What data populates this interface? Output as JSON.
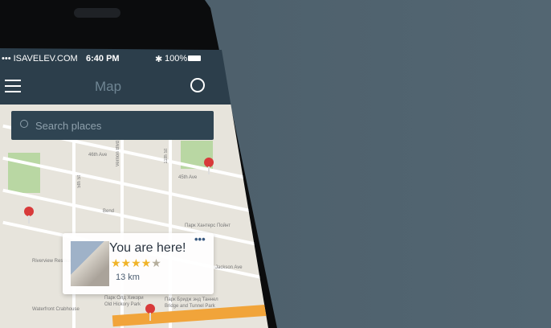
{
  "status_bar": {
    "carrier": "••• ISAVELEV.COM",
    "time": "6:40 PM",
    "bluetooth_icon": "bluetooth-icon",
    "battery": "100%"
  },
  "nav_bar": {
    "title": "Map",
    "menu_icon": "hamburger-icon",
    "locate_icon": "crosshair-icon"
  },
  "search": {
    "placeholder": "Search places"
  },
  "map_labels": [
    "46th Ave",
    "45th Ave",
    "5th St",
    "Vernon Blvd",
    "11th St",
    "Bend",
    "Парк Хантерс Пойнт",
    "Jackson Ave",
    "Парк Олд Хикори",
    "Old Hickory Park",
    "Парк Бридж энд Таннел",
    "Bridge and Tunnel Park",
    "Riverview Restaurant & Lounge",
    "Waterfront Crabhouse"
  ],
  "popup": {
    "title": "You are here!",
    "rating": 4,
    "rating_max": 5,
    "distance": "13 km",
    "more_icon": "more-dots-icon"
  },
  "colors": {
    "bar": "#2c3e4b",
    "accent_star": "#f0b429",
    "pin": "#d83a3a",
    "background": "#4d5f6b"
  }
}
